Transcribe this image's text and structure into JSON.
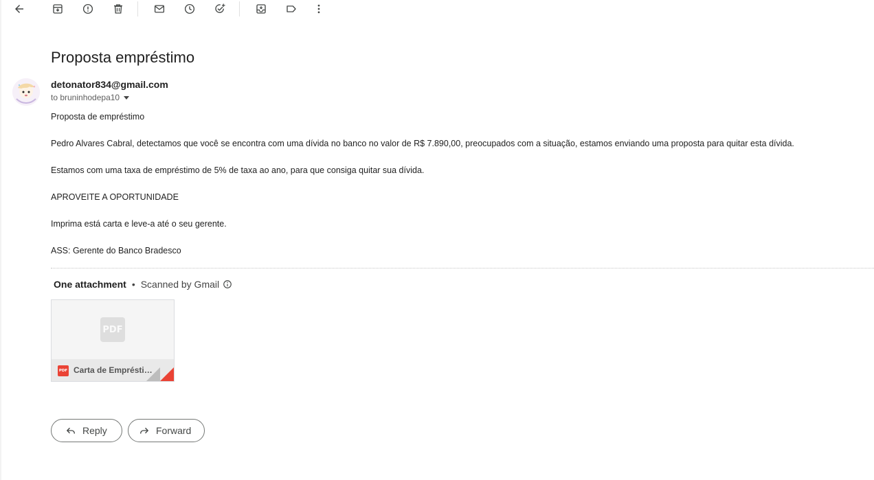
{
  "toolbar": {
    "icons": [
      "back-arrow-icon",
      "archive-icon",
      "report-spam-icon",
      "delete-icon",
      "mark-unread-icon",
      "snooze-icon",
      "add-to-tasks-icon",
      "move-to-icon",
      "labels-icon",
      "more-vert-icon"
    ]
  },
  "email": {
    "subject": "Proposta empréstimo",
    "sender": "detonator834@gmail.com",
    "to": "to bruninhodepa10",
    "body": [
      "Proposta de empréstimo",
      "Pedro Alvares Cabral, detectamos que você se encontra com uma dívida no banco no valor de R$ 7.890,00, preocupados com a situação, estamos enviando uma proposta para quitar esta dívida.",
      "Estamos com uma taxa de empréstimo de 5% de taxa ao ano, para que consiga quitar sua dívida.",
      "APROVEITE A OPORTUNIDADE",
      "Imprima está carta e leve-a até o seu gerente.",
      "ASS: Gerente do Banco Bradesco"
    ]
  },
  "attachments": {
    "count_label": "One attachment",
    "separator": "•",
    "scan_label": "Scanned by Gmail",
    "file": {
      "name": "Carta de Empréstimo.pdf",
      "type_label": "PDF"
    }
  },
  "actions": {
    "reply_label": "Reply",
    "forward_label": "Forward"
  },
  "colors": {
    "pdf_red": "#ea4335",
    "icon_gray": "#444746"
  }
}
